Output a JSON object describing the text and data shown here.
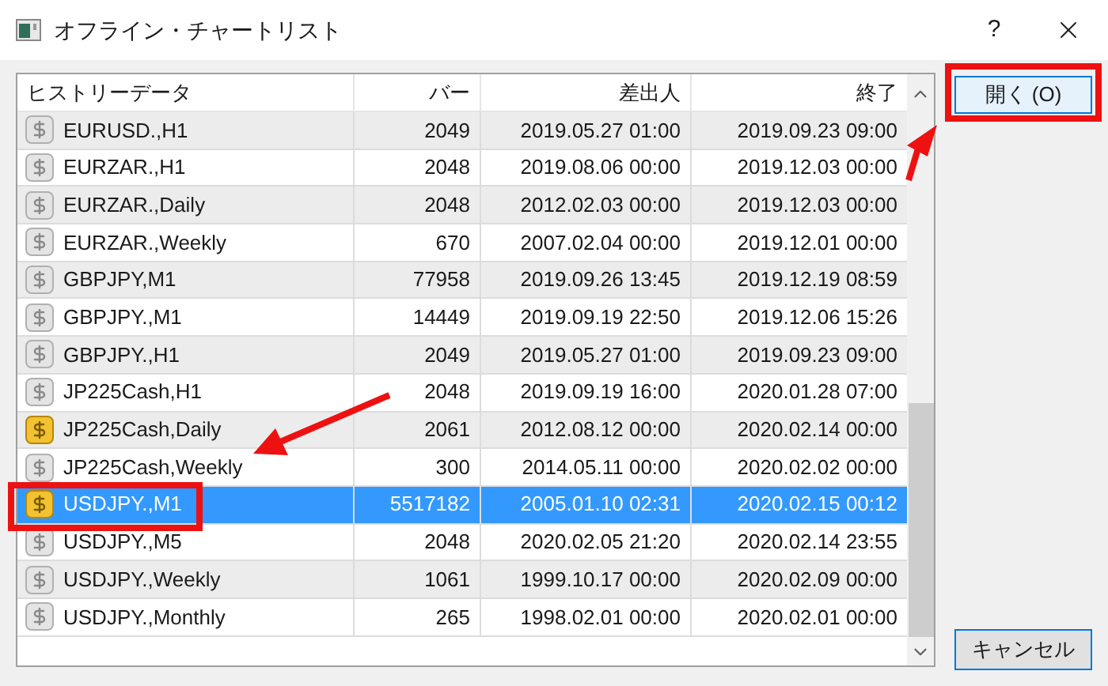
{
  "window": {
    "title": "オフライン・チャートリスト",
    "help": "?"
  },
  "table": {
    "columns": [
      "ヒストリーデータ",
      "バー",
      "差出人",
      "終了"
    ],
    "rows": [
      {
        "name": "EURUSD.,H1",
        "bars": "2049",
        "from": "2019.05.27 01:00",
        "to": "2019.09.23 09:00",
        "active": false,
        "selected": false
      },
      {
        "name": "EURZAR.,H1",
        "bars": "2048",
        "from": "2019.08.06 00:00",
        "to": "2019.12.03 00:00",
        "active": false,
        "selected": false
      },
      {
        "name": "EURZAR.,Daily",
        "bars": "2048",
        "from": "2012.02.03 00:00",
        "to": "2019.12.03 00:00",
        "active": false,
        "selected": false
      },
      {
        "name": "EURZAR.,Weekly",
        "bars": "670",
        "from": "2007.02.04 00:00",
        "to": "2019.12.01 00:00",
        "active": false,
        "selected": false
      },
      {
        "name": "GBPJPY,M1",
        "bars": "77958",
        "from": "2019.09.26 13:45",
        "to": "2019.12.19 08:59",
        "active": false,
        "selected": false
      },
      {
        "name": "GBPJPY.,M1",
        "bars": "14449",
        "from": "2019.09.19 22:50",
        "to": "2019.12.06 15:26",
        "active": false,
        "selected": false
      },
      {
        "name": "GBPJPY.,H1",
        "bars": "2049",
        "from": "2019.05.27 01:00",
        "to": "2019.09.23 09:00",
        "active": false,
        "selected": false
      },
      {
        "name": "JP225Cash,H1",
        "bars": "2048",
        "from": "2019.09.19 16:00",
        "to": "2020.01.28 07:00",
        "active": false,
        "selected": false
      },
      {
        "name": "JP225Cash,Daily",
        "bars": "2061",
        "from": "2012.08.12 00:00",
        "to": "2020.02.14 00:00",
        "active": true,
        "selected": false
      },
      {
        "name": "JP225Cash,Weekly",
        "bars": "300",
        "from": "2014.05.11 00:00",
        "to": "2020.02.02 00:00",
        "active": false,
        "selected": false
      },
      {
        "name": "USDJPY.,M1",
        "bars": "5517182",
        "from": "2005.01.10 02:31",
        "to": "2020.02.15 00:12",
        "active": true,
        "selected": true
      },
      {
        "name": "USDJPY.,M5",
        "bars": "2048",
        "from": "2020.02.05 21:20",
        "to": "2020.02.14 23:55",
        "active": false,
        "selected": false
      },
      {
        "name": "USDJPY.,Weekly",
        "bars": "1061",
        "from": "1999.10.17 00:00",
        "to": "2020.02.09 00:00",
        "active": false,
        "selected": false
      },
      {
        "name": "USDJPY.,Monthly",
        "bars": "265",
        "from": "1998.02.01 00:00",
        "to": "2020.02.01 00:00",
        "active": false,
        "selected": false
      }
    ]
  },
  "buttons": {
    "open": "開く (O)",
    "cancel": "キャンセル"
  }
}
